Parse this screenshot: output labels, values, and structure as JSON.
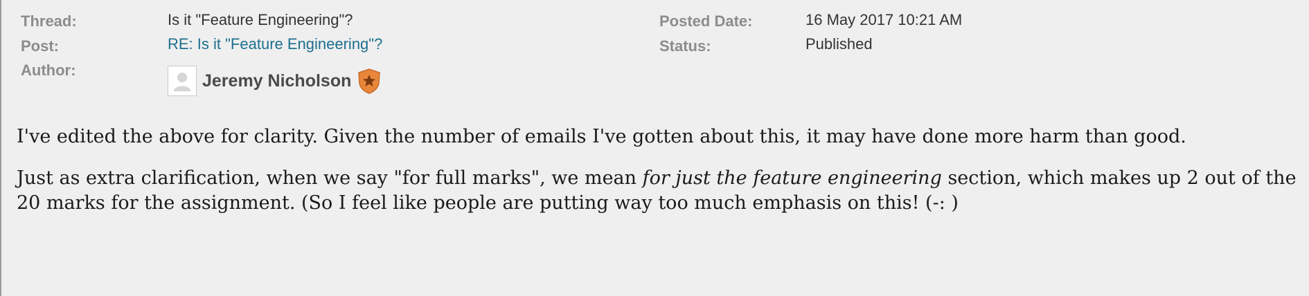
{
  "meta": {
    "thread_label": "Thread:",
    "thread_value": "Is it \"Feature Engineering\"?",
    "post_label": "Post:",
    "post_value": "RE: Is it \"Feature Engineering\"?",
    "author_label": "Author:",
    "author_name": "Jeremy Nicholson",
    "posted_date_label": "Posted Date:",
    "posted_date_value": "16 May 2017 10:21 AM",
    "status_label": "Status:",
    "status_value": "Published"
  },
  "icons": {
    "avatar": "user-silhouette-icon",
    "badge": "star-shield-badge-icon"
  },
  "colors": {
    "background": "#efefef",
    "label": "#8c8c8c",
    "link": "#1d6f8e",
    "badge": "#e8873a"
  },
  "body": {
    "p1": "I've edited the above for clarity. Given the number of emails I've gotten about this, it may have done more harm than good.",
    "p2_before": "Just as extra clarification, when we say \"for full marks\", we mean ",
    "p2_italic": "for just the feature engineering",
    "p2_after": " section, which makes up 2 out of the 20 marks for the assignment. (So I feel like people are putting way too much emphasis on this! (-: )"
  }
}
